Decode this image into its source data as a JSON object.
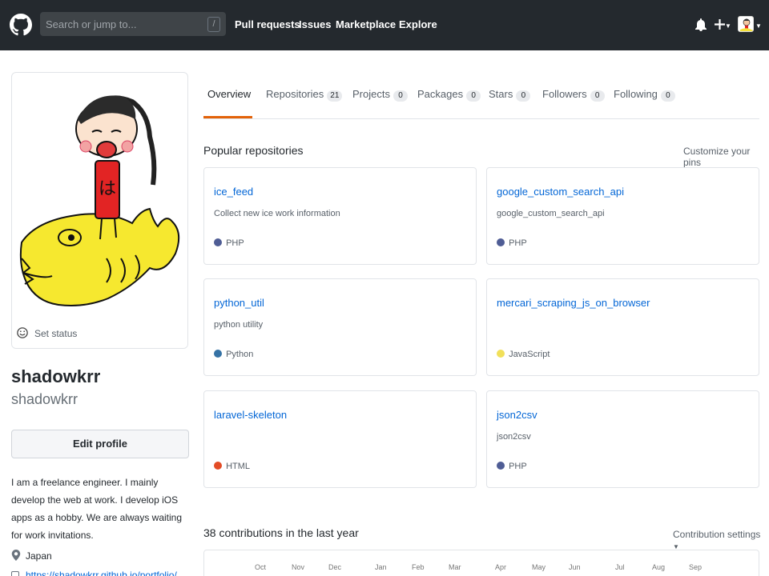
{
  "header": {
    "logo_icon": "github-octocat-icon",
    "search_placeholder": "Search or jump to...",
    "search_shortcut": "/",
    "nav": [
      "Pull requests",
      "Issues",
      "Marketplace",
      "Explore"
    ],
    "icons": [
      "bell-icon",
      "plus-icon",
      "avatar"
    ]
  },
  "profile": {
    "set_status": "Set status",
    "fullname": "shadowkrr",
    "username": "shadowkrr",
    "edit_profile": "Edit profile",
    "bio": "I am a freelance engineer. I mainly develop the web at work. I develop iOS apps as a hobby. We are always waiting for work invitations.",
    "location": "Japan",
    "url": "https://shadowkrr.github.io/portfolio/"
  },
  "tabs": [
    {
      "label": "Overview",
      "count": null
    },
    {
      "label": "Repositories",
      "count": "21"
    },
    {
      "label": "Projects",
      "count": "0"
    },
    {
      "label": "Packages",
      "count": "0"
    },
    {
      "label": "Stars",
      "count": "0"
    },
    {
      "label": "Followers",
      "count": "0"
    },
    {
      "label": "Following",
      "count": "0"
    }
  ],
  "popular": {
    "title": "Popular repositories",
    "customize": "Customize your pins",
    "repos": [
      {
        "name": "ice_feed",
        "desc": "Collect new ice work information",
        "lang": "PHP",
        "color": "#4F5D95"
      },
      {
        "name": "google_custom_search_api",
        "desc": "google_custom_search_api",
        "lang": "PHP",
        "color": "#4F5D95"
      },
      {
        "name": "python_util",
        "desc": "python utility",
        "lang": "Python",
        "color": "#3572A5"
      },
      {
        "name": "mercari_scraping_js_on_browser",
        "desc": "",
        "lang": "JavaScript",
        "color": "#f1e05a"
      },
      {
        "name": "laravel-skeleton",
        "desc": "",
        "lang": "HTML",
        "color": "#e34c26"
      },
      {
        "name": "json2csv",
        "desc": "json2csv",
        "lang": "PHP",
        "color": "#4F5D95"
      }
    ]
  },
  "contributions": {
    "title": "38 contributions in the last year",
    "settings": "Contribution settings",
    "months": [
      "Oct",
      "Nov",
      "Dec",
      "Jan",
      "Feb",
      "Mar",
      "Apr",
      "May",
      "Jun",
      "Jul",
      "Aug",
      "Sep"
    ]
  },
  "colors": {
    "header_bg": "#24292e",
    "link": "#0366d6",
    "tab_underline": "#e36209"
  }
}
